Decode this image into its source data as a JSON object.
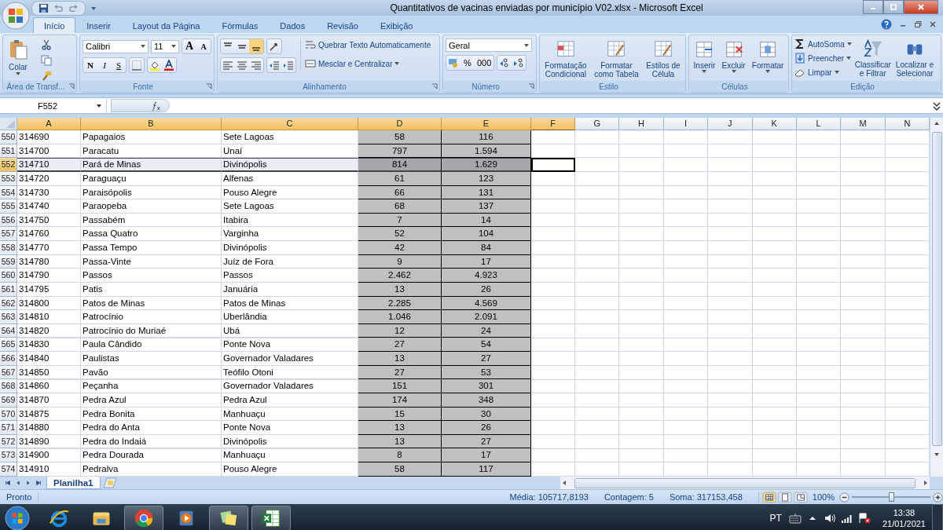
{
  "window": {
    "title": "Quantitativos de vacinas enviadas por município V02.xlsx - Microsoft Excel"
  },
  "tabs": [
    {
      "label": "Início",
      "selected": true
    },
    {
      "label": "Inserir",
      "selected": false
    },
    {
      "label": "Layout da Página",
      "selected": false
    },
    {
      "label": "Fórmulas",
      "selected": false
    },
    {
      "label": "Dados",
      "selected": false
    },
    {
      "label": "Revisão",
      "selected": false
    },
    {
      "label": "Exibição",
      "selected": false
    }
  ],
  "ribbon": {
    "clipboard": {
      "title": "Área de Transf...",
      "paste": "Colar"
    },
    "font": {
      "title": "Fonte",
      "family": "Calibri",
      "size": "11",
      "grow": "A",
      "shrink": "A",
      "bold": "N",
      "italic": "I",
      "underline": "S"
    },
    "alignment": {
      "title": "Alinhamento",
      "wrap": "Quebrar Texto Automaticamente",
      "merge": "Mesclar e Centralizar",
      "vertical": [
        {
          "selected": false
        },
        {
          "selected": false
        },
        {
          "selected": true
        }
      ]
    },
    "number": {
      "title": "Número",
      "format": "Geral",
      "percent": "%",
      "thousands": "000"
    },
    "styles": {
      "title": "Estilo",
      "buttons": [
        {
          "lines": [
            "Formatação",
            "Condicional"
          ]
        },
        {
          "lines": [
            "Formatar",
            "como Tabela"
          ]
        },
        {
          "lines": [
            "Estilos de",
            "Célula"
          ]
        }
      ]
    },
    "cells": {
      "title": "Células",
      "buttons": [
        "Inserir",
        "Excluir",
        "Formatar"
      ]
    },
    "editing": {
      "title": "Edição",
      "small": [
        "AutoSoma",
        "Preencher",
        "Limpar"
      ],
      "large": [
        {
          "lines": [
            "Classificar",
            "e Filtrar"
          ]
        },
        {
          "lines": [
            "Localizar e",
            "Selecionar"
          ]
        }
      ]
    }
  },
  "name_box": "F552",
  "columns": [
    {
      "label": "A",
      "selected": true,
      "shaded": false,
      "active": false
    },
    {
      "label": "B",
      "selected": true,
      "shaded": false,
      "active": false
    },
    {
      "label": "C",
      "selected": true,
      "shaded": false,
      "active": false
    },
    {
      "label": "D",
      "selected": true,
      "shaded": true,
      "active": false
    },
    {
      "label": "E",
      "selected": true,
      "shaded": true,
      "active": false
    },
    {
      "label": "F",
      "selected": true,
      "shaded": false,
      "active": true
    },
    {
      "label": "G",
      "selected": false,
      "shaded": false,
      "active": false
    },
    {
      "label": "H",
      "selected": false,
      "shaded": false,
      "active": false
    },
    {
      "label": "I",
      "selected": false,
      "shaded": false,
      "active": false
    },
    {
      "label": "J",
      "selected": false,
      "shaded": false,
      "active": false
    },
    {
      "label": "K",
      "selected": false,
      "shaded": false,
      "active": false
    },
    {
      "label": "L",
      "selected": false,
      "shaded": false,
      "active": false
    },
    {
      "label": "M",
      "selected": false,
      "shaded": false,
      "active": false
    },
    {
      "label": "N",
      "selected": false,
      "shaded": false,
      "active": false
    }
  ],
  "rows": [
    {
      "number": "550",
      "selected": false,
      "cells": [
        "314690",
        "Papagaios",
        "Sete Lagoas",
        "58",
        "116"
      ]
    },
    {
      "number": "551",
      "selected": false,
      "cells": [
        "314700",
        "Paracatu",
        "Unaí",
        "797",
        "1.594"
      ]
    },
    {
      "number": "552",
      "selected": true,
      "cells": [
        "314710",
        "Pará de Minas",
        "Divinópolis",
        "814",
        "1.629"
      ]
    },
    {
      "number": "553",
      "selected": false,
      "cells": [
        "314720",
        "Paraguaçu",
        "Alfenas",
        "61",
        "123"
      ]
    },
    {
      "number": "554",
      "selected": false,
      "cells": [
        "314730",
        "Paraisópolis",
        "Pouso Alegre",
        "66",
        "131"
      ]
    },
    {
      "number": "555",
      "selected": false,
      "cells": [
        "314740",
        "Paraopeba",
        "Sete Lagoas",
        "68",
        "137"
      ]
    },
    {
      "number": "556",
      "selected": false,
      "cells": [
        "314750",
        "Passabém",
        "Itabira",
        "7",
        "14"
      ]
    },
    {
      "number": "557",
      "selected": false,
      "cells": [
        "314760",
        "Passa Quatro",
        "Varginha",
        "52",
        "104"
      ]
    },
    {
      "number": "558",
      "selected": false,
      "cells": [
        "314770",
        "Passa Tempo",
        "Divinópolis",
        "42",
        "84"
      ]
    },
    {
      "number": "559",
      "selected": false,
      "cells": [
        "314780",
        "Passa-Vinte",
        "Juíz de Fora",
        "9",
        "17"
      ]
    },
    {
      "number": "560",
      "selected": false,
      "cells": [
        "314790",
        "Passos",
        "Passos",
        "2.462",
        "4.923"
      ]
    },
    {
      "number": "561",
      "selected": false,
      "cells": [
        "314795",
        "Patis",
        "Januária",
        "13",
        "26"
      ]
    },
    {
      "number": "562",
      "selected": false,
      "cells": [
        "314800",
        "Patos de Minas",
        "Patos de Minas",
        "2.285",
        "4.569"
      ]
    },
    {
      "number": "563",
      "selected": false,
      "cells": [
        "314810",
        "Patrocínio",
        "Uberlândia",
        "1.046",
        "2.091"
      ]
    },
    {
      "number": "564",
      "selected": false,
      "cells": [
        "314820",
        "Patrocínio do Muriaé",
        "Ubá",
        "12",
        "24"
      ]
    },
    {
      "number": "565",
      "selected": false,
      "cells": [
        "314830",
        "Paula Cândido",
        "Ponte Nova",
        "27",
        "54"
      ]
    },
    {
      "number": "566",
      "selected": false,
      "cells": [
        "314840",
        "Paulistas",
        "Governador Valadares",
        "13",
        "27"
      ]
    },
    {
      "number": "567",
      "selected": false,
      "cells": [
        "314850",
        "Pavão",
        "Teófilo Otoni",
        "27",
        "53"
      ]
    },
    {
      "number": "568",
      "selected": false,
      "cells": [
        "314860",
        "Peçanha",
        "Governador Valadares",
        "151",
        "301"
      ]
    },
    {
      "number": "569",
      "selected": false,
      "cells": [
        "314870",
        "Pedra Azul",
        "Pedra Azul",
        "174",
        "348"
      ]
    },
    {
      "number": "570",
      "selected": false,
      "cells": [
        "314875",
        "Pedra Bonita",
        "Manhuaçu",
        "15",
        "30"
      ]
    },
    {
      "number": "571",
      "selected": false,
      "cells": [
        "314880",
        "Pedra do Anta",
        "Ponte Nova",
        "13",
        "26"
      ]
    },
    {
      "number": "572",
      "selected": false,
      "cells": [
        "314890",
        "Pedra do Indaiá",
        "Divinópolis",
        "13",
        "27"
      ]
    },
    {
      "number": "573",
      "selected": false,
      "cells": [
        "314900",
        "Pedra Dourada",
        "Manhuaçu",
        "8",
        "17"
      ]
    },
    {
      "number": "574",
      "selected": false,
      "cells": [
        "314910",
        "Pedralva",
        "Pouso Alegre",
        "58",
        "117"
      ]
    }
  ],
  "sheet_tabs": [
    {
      "label": "Planilha1",
      "selected": true
    }
  ],
  "status_bar": {
    "mode": "Pronto",
    "average": "Média: 105717,8193",
    "count": "Contagem: 5",
    "sum": "Soma: 317153,458",
    "views": [
      {
        "selected": true
      },
      {
        "selected": false
      },
      {
        "selected": false
      }
    ],
    "zoom": "100%",
    "zoom_level": {
      "level": 0.5
    }
  },
  "taskbar": {
    "apps": [
      {
        "kind": "browser-e",
        "running": false
      },
      {
        "kind": "folder",
        "running": false
      },
      {
        "kind": "chrome",
        "running": true
      },
      {
        "kind": "media",
        "running": false
      },
      {
        "kind": "notes",
        "running": true
      },
      {
        "kind": "sheet",
        "running": true
      }
    ],
    "language": "PT",
    "time": "13:38",
    "date": "21/01/2021"
  }
}
